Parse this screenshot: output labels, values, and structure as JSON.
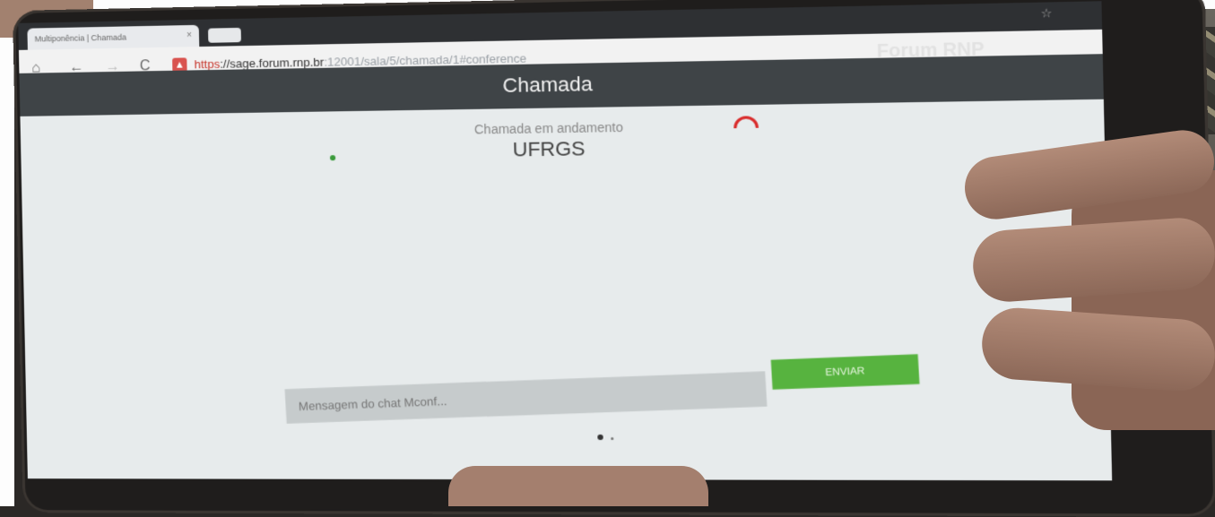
{
  "browser": {
    "tab_title": "Multiponência | Chamada",
    "tab_close": "×",
    "url_scheme": "https",
    "url_host": "://sage.forum.rnp.br",
    "url_path": ":12001/sala/5/chamada/1#conference",
    "back_icon": "←",
    "forward_icon": "→",
    "reload_icon": "C",
    "home_icon": "⌂",
    "star_icon": "☆"
  },
  "app": {
    "title": "Chamada",
    "brand": "Forum RNP"
  },
  "call": {
    "status": "Chamada em andamento",
    "contact": "UFRGS"
  },
  "chat": {
    "placeholder": "Mensagem do chat Mconf...",
    "send_label": "ENVIAR"
  },
  "colors": {
    "send_button": "#57b33f",
    "hangup": "#d92b2b",
    "app_bar": "#3f4447"
  }
}
